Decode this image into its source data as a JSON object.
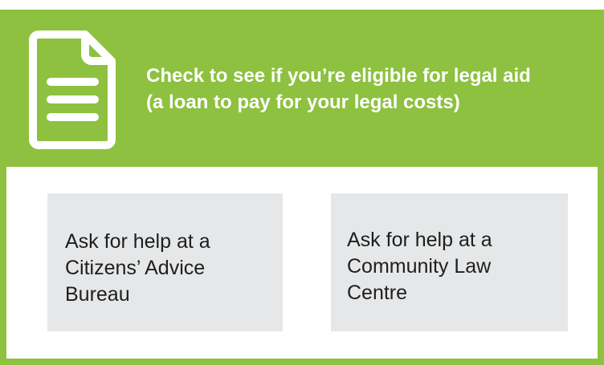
{
  "banner": {
    "icon": "document-icon",
    "line1": "Check to see if you’re eligible for legal aid",
    "line2": "(a loan to pay for your legal costs)"
  },
  "options": [
    {
      "lines": [
        "Ask for help at a",
        "Citizens’ Advice",
        "Bureau"
      ]
    },
    {
      "lines": [
        "Ask for help at a",
        "Community Law",
        "Centre"
      ]
    }
  ],
  "colors": {
    "accent_green": "#8dc13f",
    "box_gray": "#e6e7e8",
    "text_dark": "#1e1e1e",
    "text_light": "#ffffff"
  }
}
